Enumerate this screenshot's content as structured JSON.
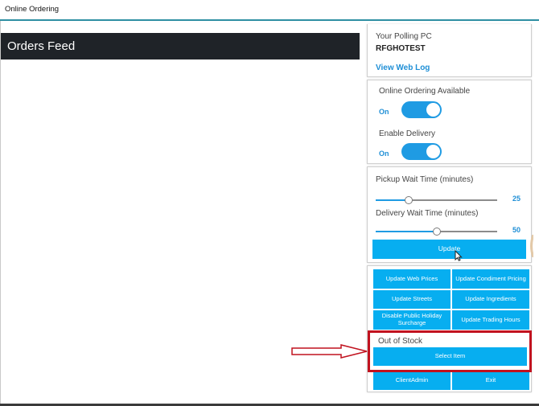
{
  "window": {
    "title": "Online Ordering"
  },
  "orders": {
    "title": "Orders Feed"
  },
  "polling": {
    "label": "Your Polling PC",
    "pc_name": "RFGHOTEST",
    "web_log_link": "View Web Log"
  },
  "toggles": {
    "online_ordering": {
      "label": "Online Ordering Available",
      "state": "On"
    },
    "delivery": {
      "label": "Enable Delivery",
      "state": "On"
    }
  },
  "wait_times": {
    "pickup": {
      "label": "Pickup Wait Time (minutes)",
      "value": "25",
      "fraction": 0.27
    },
    "delivery": {
      "label": "Delivery Wait Time (minutes)",
      "value": "50",
      "fraction": 0.5
    },
    "update_label": "Update"
  },
  "actions": {
    "update_web_prices": "Update Web Prices",
    "update_condiment_pricing": "Update Condiment Pricing",
    "update_streets": "Update Streets",
    "update_ingredients": "Update Ingredients",
    "disable_holiday": "Disable Public Holiday Surcharge",
    "update_trading_hours": "Update Trading Hours"
  },
  "out_of_stock": {
    "label": "Out of Stock",
    "select_item": "Select Item"
  },
  "footer": {
    "client_admin": "ClientAdmin",
    "exit": "Exit"
  },
  "colors": {
    "accent": "#07aef0",
    "toggle": "#1f9be3",
    "link": "#1f8fd6",
    "highlight": "#c1121f",
    "header": "#1f2328"
  }
}
